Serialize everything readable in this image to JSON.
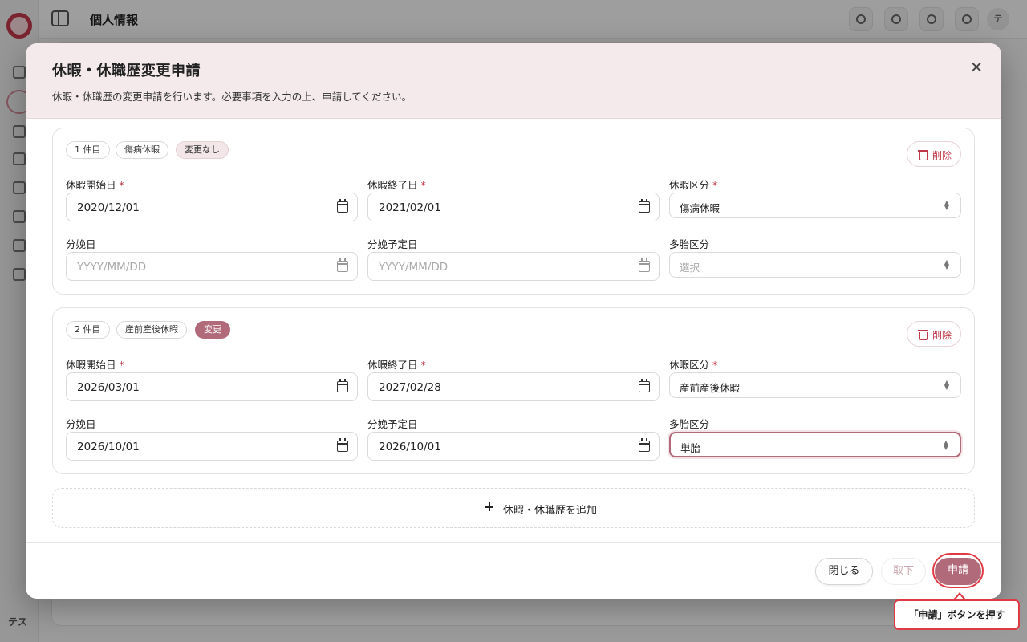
{
  "background": {
    "page_title": "個人情報",
    "user_initials": "テス",
    "avatar_initial": "テ"
  },
  "dialog": {
    "title": "休暇・休職歴変更申請",
    "description": "休暇・休職歴の変更申請を行います。必要事項を入力の上、申請してください。",
    "records": [
      {
        "count_label": "1 件目",
        "type_badge": "傷病休暇",
        "status_badge": "変更なし",
        "delete_label": "削除",
        "start_label": "休暇開始日",
        "start_value": "2020/12/01",
        "end_label": "休暇終了日",
        "end_value": "2021/02/01",
        "category_label": "休暇区分",
        "category_value": "傷病休暇",
        "delivery_label": "分娩日",
        "delivery_placeholder": "YYYY/MM/DD",
        "due_label": "分娩予定日",
        "due_placeholder": "YYYY/MM/DD",
        "multiple_label": "多胎区分",
        "multiple_placeholder": "選択"
      },
      {
        "count_label": "2 件目",
        "type_badge": "産前産後休暇",
        "status_badge": "変更",
        "delete_label": "削除",
        "start_label": "休暇開始日",
        "start_value": "2026/03/01",
        "end_label": "休暇終了日",
        "end_value": "2027/02/28",
        "category_label": "休暇区分",
        "category_value": "産前産後休暇",
        "delivery_label": "分娩日",
        "delivery_value": "2026/10/01",
        "due_label": "分娩予定日",
        "due_value": "2026/10/01",
        "multiple_label": "多胎区分",
        "multiple_value": "単胎"
      }
    ],
    "required_mark": "*",
    "add_label": "休暇・休職歴を追加",
    "footer": {
      "close_label": "閉じる",
      "withdraw_label": "取下",
      "apply_label": "申請"
    }
  },
  "callout": {
    "text": "「申請」ボタンを押す"
  },
  "colors": {
    "accent": "#b06a7a",
    "required": "#c0394b",
    "highlight": "#e03a44",
    "header_bg": "#f4eaec"
  },
  "icons": [
    "close-icon",
    "trash-icon",
    "calendar-icon",
    "chevron-updown-icon",
    "plus-icon",
    "sidebar-toggle-icon"
  ]
}
